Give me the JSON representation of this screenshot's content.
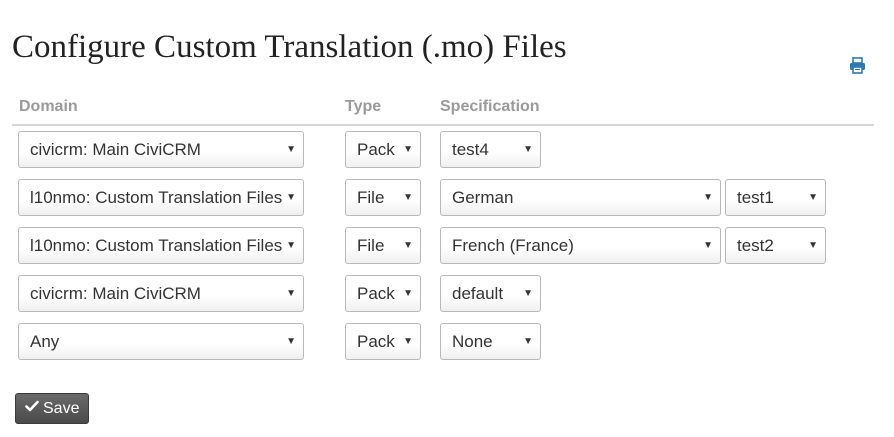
{
  "page": {
    "title": "Configure Custom Translation (.mo) Files"
  },
  "toolbar": {
    "print_icon": "print-icon"
  },
  "table": {
    "columns": [
      "Domain",
      "Type",
      "Specification"
    ],
    "rows": [
      {
        "domain": "civicrm: Main CiviCRM",
        "type": "Pack",
        "spec": "test4"
      },
      {
        "domain": "l10nmo: Custom Translation Files",
        "type": "File",
        "spec": "German",
        "file": "test1"
      },
      {
        "domain": "l10nmo: Custom Translation Files",
        "type": "File",
        "spec": "French (France)",
        "file": "test2"
      },
      {
        "domain": "civicrm: Main CiviCRM",
        "type": "Pack",
        "spec": "default"
      },
      {
        "domain": "Any",
        "type": "Pack",
        "spec": "None"
      }
    ]
  },
  "actions": {
    "save_label": "Save",
    "save_icon": "check-icon"
  },
  "colors": {
    "print_icon": "#2a7ab8",
    "save_button": "#555555"
  }
}
